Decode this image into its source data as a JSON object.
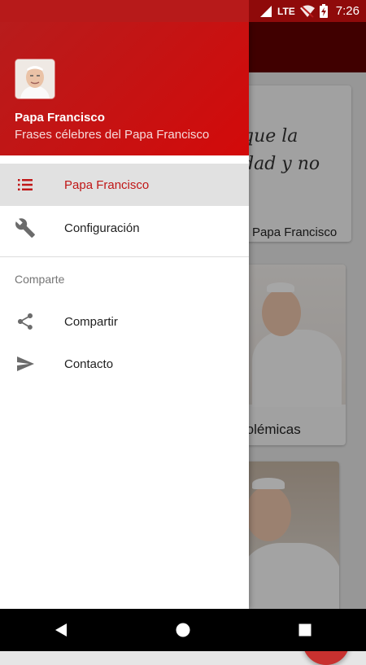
{
  "status_bar": {
    "network": "LTE",
    "time": "7:26"
  },
  "background": {
    "card1": {
      "quote_line1": "que la",
      "quote_line2": "dad y no",
      "caption": "Papa Francisco"
    },
    "card2": {
      "caption": "s polémicas"
    }
  },
  "drawer": {
    "header": {
      "title": "Papa Francisco",
      "subtitle": "Frases célebres del Papa Francisco"
    },
    "items": [
      {
        "label": "Papa Francisco",
        "icon": "list-icon",
        "selected": true
      },
      {
        "label": "Configuración",
        "icon": "wrench-icon"
      }
    ],
    "section": "Comparte",
    "section_items": [
      {
        "label": "Compartir",
        "icon": "share-icon"
      },
      {
        "label": "Contacto",
        "icon": "send-icon"
      }
    ]
  },
  "colors": {
    "primary": "#b71c1c",
    "accent": "#d30a0a",
    "selected_text": "#c01616"
  }
}
